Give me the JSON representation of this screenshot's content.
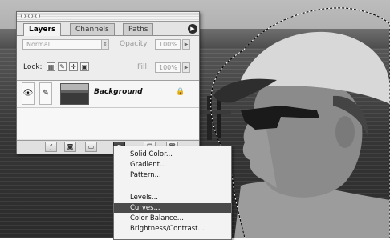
{
  "palette": {
    "tabs": [
      "Layers",
      "Channels",
      "Paths"
    ],
    "active_tab": "Layers",
    "blend_mode": "Normal",
    "opacity_label": "Opacity:",
    "opacity_value": "100%",
    "lock_label": "Lock:",
    "fill_label": "Fill:",
    "fill_value": "100%",
    "layer": {
      "name": "Background",
      "visible": true,
      "locked": true
    },
    "bottom_buttons": [
      "layer-style-icon",
      "layer-mask-icon",
      "new-group-icon",
      "adjustment-layer-icon",
      "new-layer-icon",
      "trash-icon"
    ]
  },
  "adjustment_menu": {
    "items": [
      "Solid Color...",
      "Gradient...",
      "Pattern...",
      "Levels...",
      "Curves...",
      "Color Balance...",
      "Brightness/Contrast..."
    ],
    "highlighted": "Curves..."
  },
  "colors": {
    "menu_highlight": "#4a4a4a",
    "active_tab": "#f4f4f4",
    "pressed_button": "#2c2c2c"
  }
}
